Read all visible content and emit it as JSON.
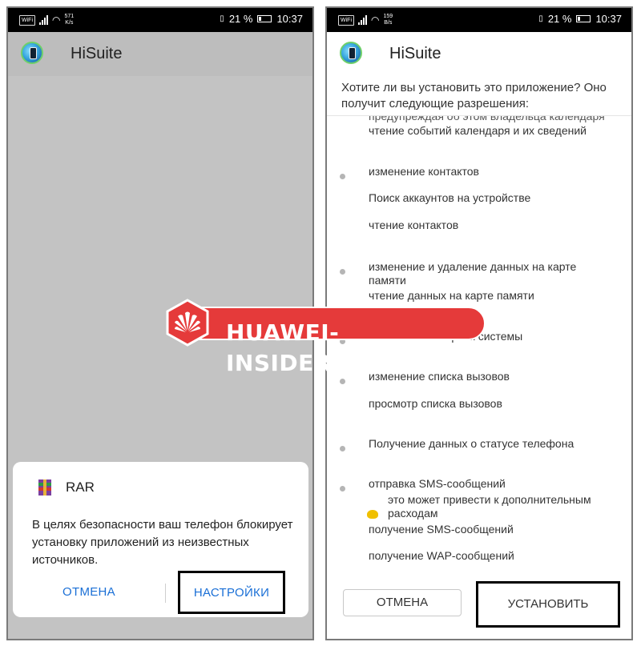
{
  "status_left": {
    "sim": "WiFi",
    "speed_value": "571",
    "speed_unit": "K/s",
    "battery": "21 %",
    "time": "10:37"
  },
  "status_right": {
    "sim": "WiFi",
    "speed_value": "159",
    "speed_unit": "B/s",
    "battery": "21 %",
    "time": "10:37"
  },
  "left": {
    "app_title": "HiSuite",
    "dialog": {
      "title": "RAR",
      "text": "В целях безопасности ваш телефон блокирует установку приложений из неизвестных источников.",
      "cancel": "ОТМЕНА",
      "settings": "НАСТРОЙКИ"
    }
  },
  "right": {
    "app_title": "HiSuite",
    "question": "Хотите ли вы установить это приложение? Оно получит следующие разрешения:",
    "permissions": {
      "clipped": "предупреждая об этом владельца календаря",
      "p0": "чтение событий календаря и их сведений",
      "p1": "изменение контактов",
      "p2": "Поиск аккаунтов на устройстве",
      "p3": "чтение контактов",
      "p4": "изменение и удаление данных на карте памяти",
      "p5": "чтение данных на карте памяти",
      "p6": "изменение настроек системы",
      "p7": "изменение списка вызовов",
      "p8": "просмотр списка вызовов",
      "p9": "Получение данных о статусе телефона",
      "p10": "отправка SMS-сообщений",
      "p10_warning": "это может привести к дополнительным расходам",
      "p11": "получение SMS-сообщений",
      "p12": "получение WAP-сообщений"
    },
    "cancel": "ОТМЕНА",
    "install": "УСТАНОВИТЬ"
  },
  "watermark": "HUAWEI-INSIDER.COM",
  "colors": {
    "accent_blue": "#1a6fd6",
    "watermark_red": "#e53a3a",
    "dim_overlay": "#c3c3c3"
  }
}
